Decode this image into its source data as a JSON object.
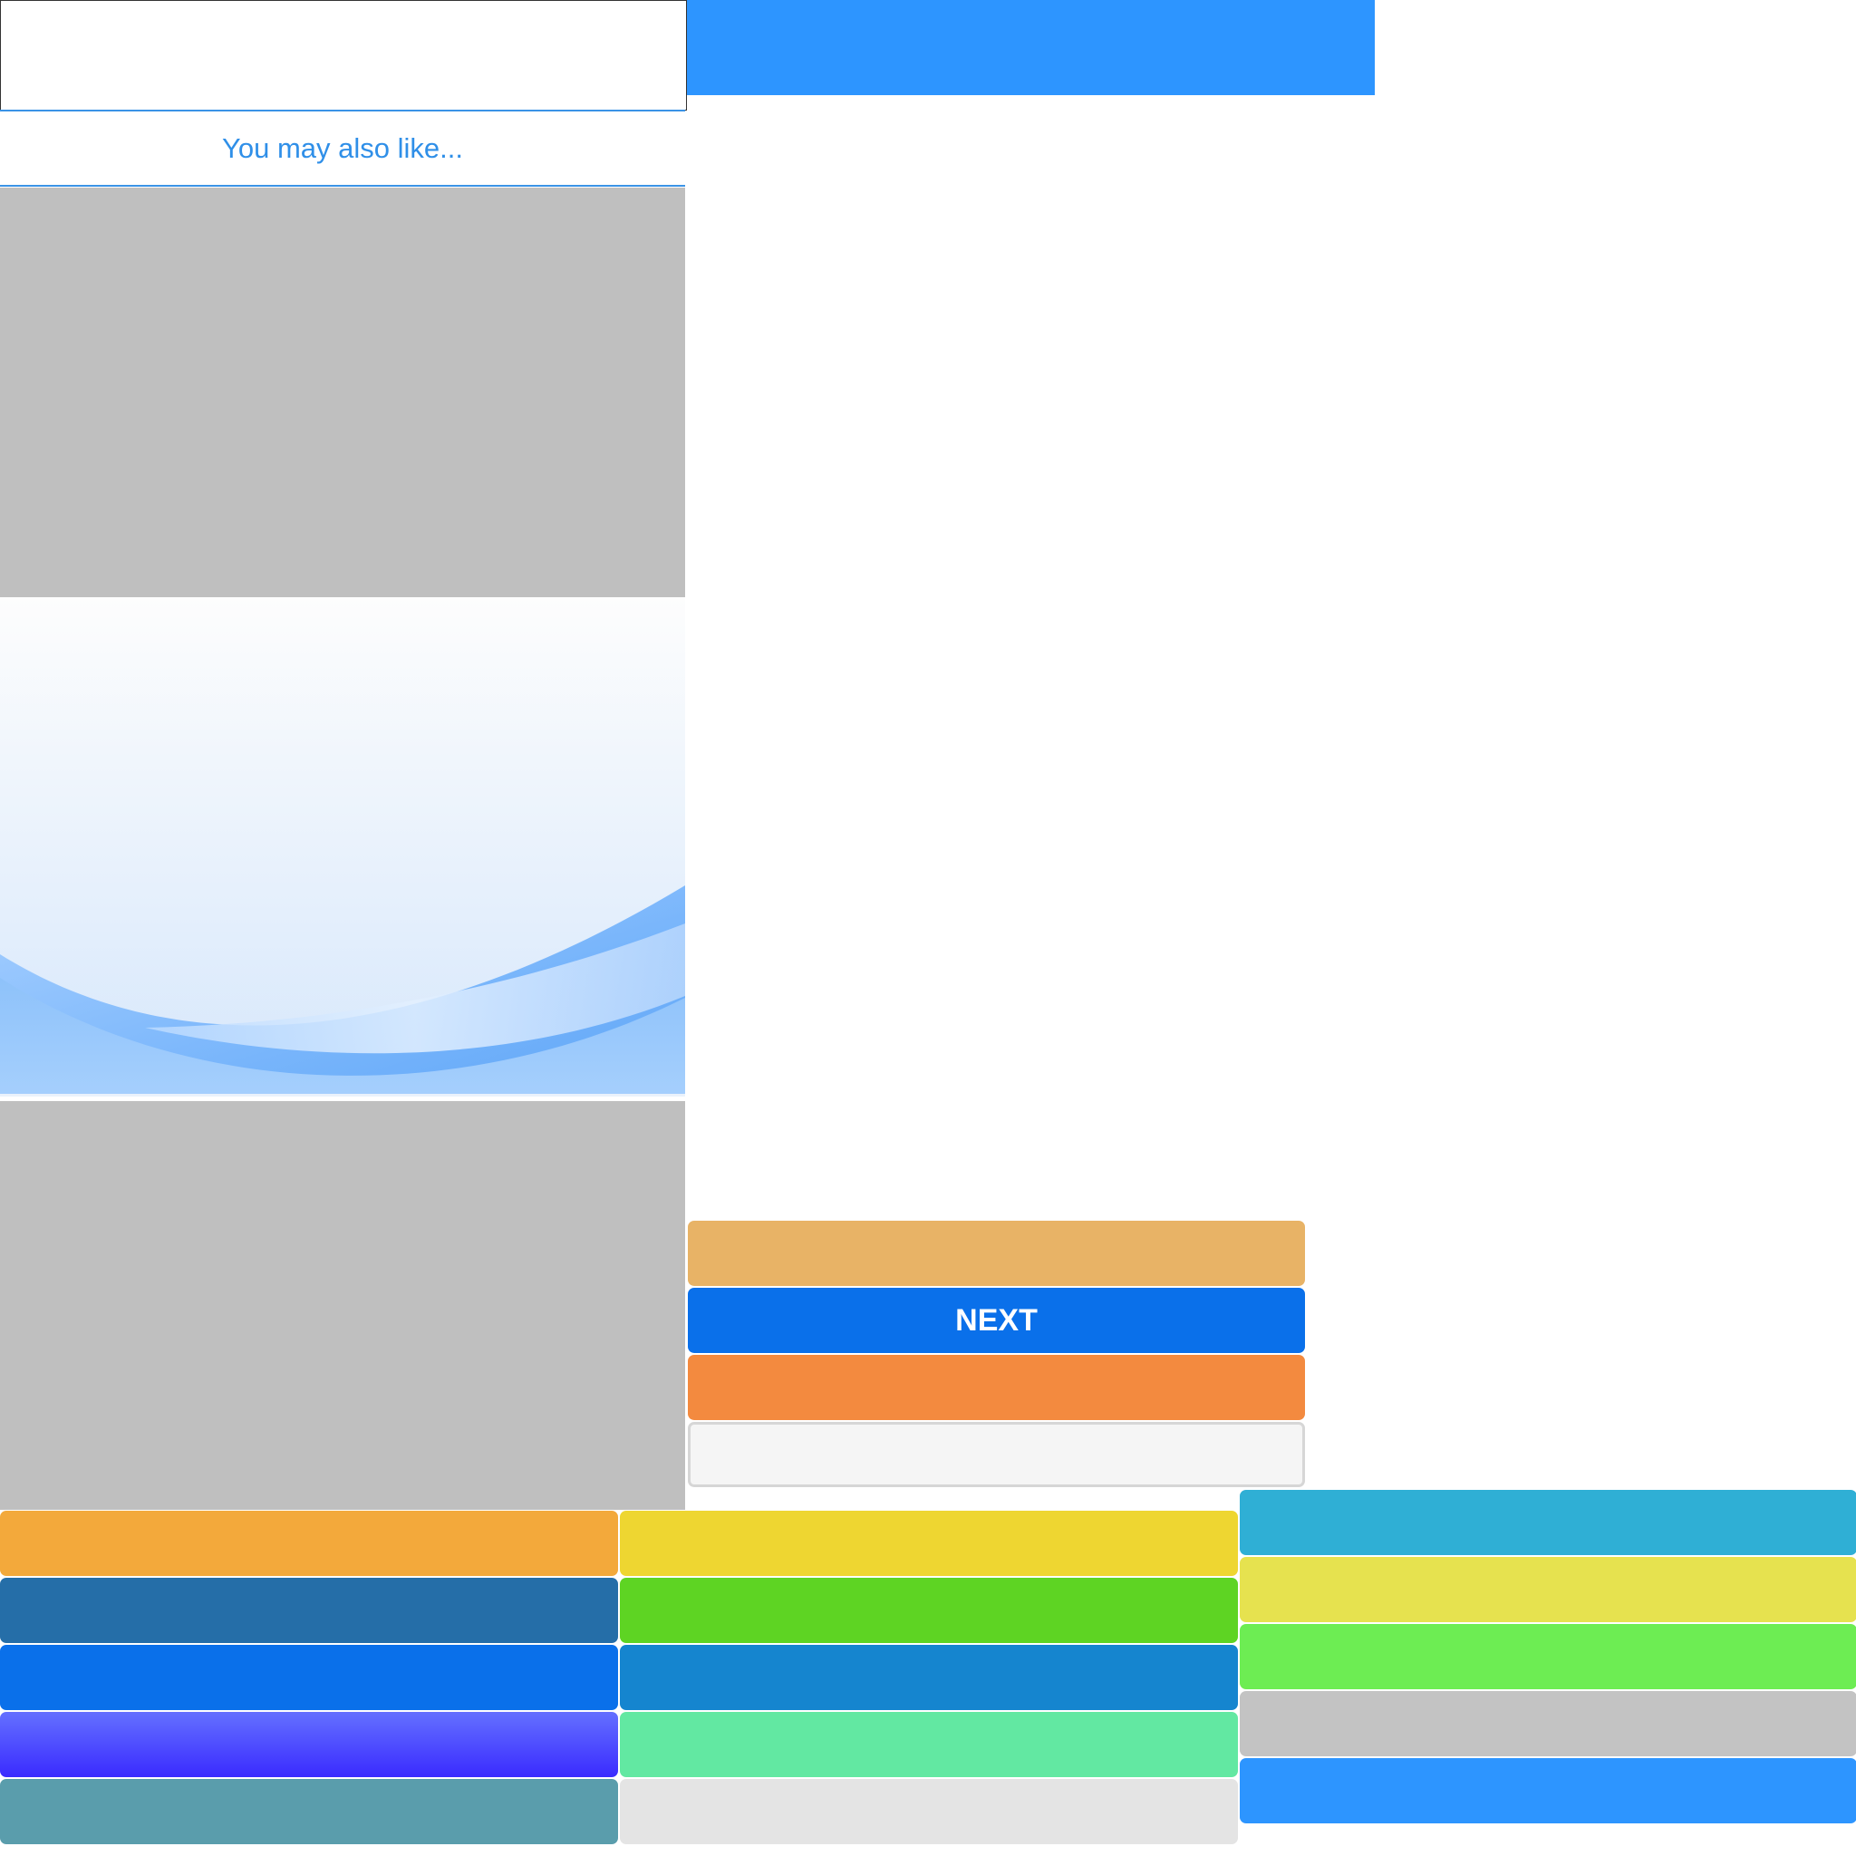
{
  "header": {
    "search_value": "",
    "bar_color": "#2d95ff"
  },
  "recommendations": {
    "heading": "You may also like..."
  },
  "middle_buttons": [
    {
      "id": "btn-sand",
      "label": "",
      "color": "#e8b366"
    },
    {
      "id": "btn-next",
      "label": "NEXT",
      "color": "#0a70ea"
    },
    {
      "id": "btn-orange",
      "label": "",
      "color": "#f38a3f"
    },
    {
      "id": "btn-light",
      "label": "",
      "color": "#f5f5f5"
    }
  ],
  "grid_buttons": {
    "column_a": [
      {
        "label": "",
        "color": "#f3a93b"
      },
      {
        "label": "",
        "color": "#256ea8"
      },
      {
        "label": "",
        "color": "#0a70ea"
      },
      {
        "label": "",
        "color": "gradient-violet"
      },
      {
        "label": "",
        "color": "#5a9dac"
      }
    ],
    "column_b": [
      {
        "label": "",
        "color": "#eed631"
      },
      {
        "label": "",
        "color": "#5ed423"
      },
      {
        "label": "",
        "color": "#1585cf"
      },
      {
        "label": "",
        "color": "#62e8a2"
      },
      {
        "label": "",
        "color": "#e4e4e4"
      }
    ],
    "column_c": [
      {
        "label": "",
        "color": "#2fafd5"
      },
      {
        "label": "",
        "color": "#e6e24f"
      },
      {
        "label": "",
        "color": "#6ded53"
      },
      {
        "label": "",
        "color": "#c3c3c3"
      },
      {
        "label": "",
        "color": "#2d95ff"
      }
    ]
  }
}
